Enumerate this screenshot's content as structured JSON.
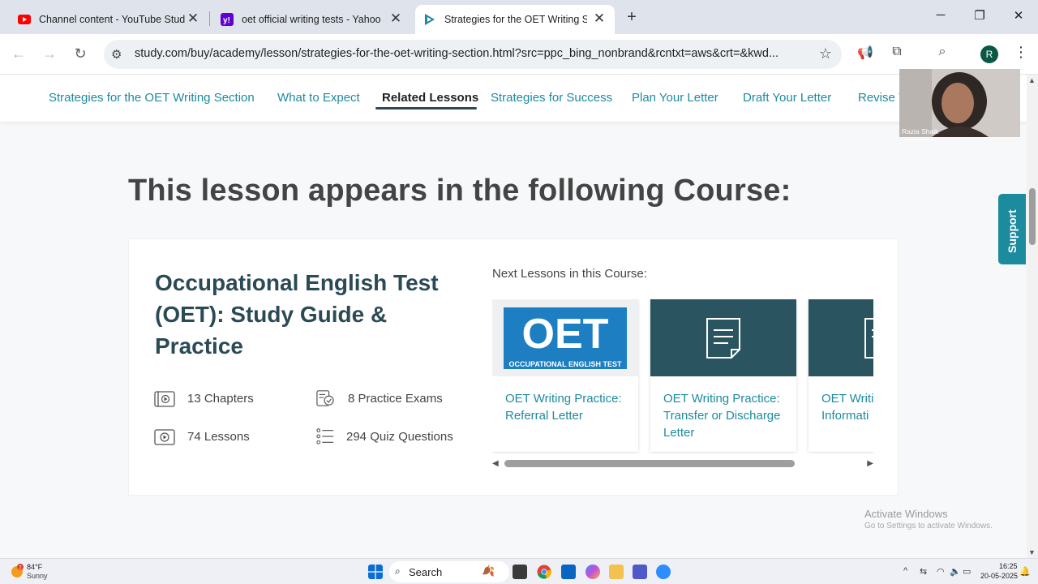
{
  "browser": {
    "tabs": [
      {
        "title": "Channel content - YouTube Studio",
        "icon": "youtube-icon",
        "active": false
      },
      {
        "title": "oet official writing tests - Yahoo Se",
        "icon": "yahoo-icon",
        "active": false
      },
      {
        "title": "Strategies for the OET Writing Sect",
        "icon": "study-com-icon",
        "active": true
      }
    ],
    "url": "study.com/buy/academy/lesson/strategies-for-the-oet-writing-section.html?src=ppc_bing_nonbrand&rcntxt=aws&crt=&kwd...",
    "profile_initial": "R"
  },
  "lesson_nav": {
    "items": [
      "Strategies for the OET Writing Section",
      "What to Expect",
      "Related Lessons",
      "Strategies for Success",
      "Plan Your Letter",
      "Draft Your Letter",
      "Revise Y"
    ],
    "active_index": 2
  },
  "main": {
    "heading": "This lesson appears in the following Course:",
    "course": {
      "title": "Occupational English Test (OET): Study Guide & Practice",
      "stats": {
        "chapters": "13 Chapters",
        "practice_exams": "8 Practice Exams",
        "lessons": "74 Lessons",
        "quiz_questions": "294 Quiz Questions"
      },
      "next_label": "Next Lessons in this Course:",
      "next_lessons": [
        {
          "title": "OET Writing Practice: Referral Letter",
          "thumb": "oet-logo"
        },
        {
          "title": "OET Writing Practice: Transfer or Discharge Letter",
          "thumb": "document-icon"
        },
        {
          "title": "OET Writi Informati",
          "thumb": "document-icon"
        }
      ],
      "oet_logo_text": "OET",
      "oet_logo_sub": "OCCUPATIONAL ENGLISH TEST"
    },
    "support_label": "Support"
  },
  "webcam": {
    "name": "Razia Shaik"
  },
  "watermark": {
    "title": "Activate Windows",
    "subtitle": "Go to Settings to activate Windows."
  },
  "taskbar": {
    "weather_temp": "84°F",
    "weather_cond": "Sunny",
    "weather_badge": "2",
    "search_label": "Search",
    "time": "16:25",
    "date": "20-05-2025"
  },
  "colors": {
    "accent": "#1c8b9e",
    "heading": "#2b4a55",
    "dark_thumb": "#2a5560"
  }
}
